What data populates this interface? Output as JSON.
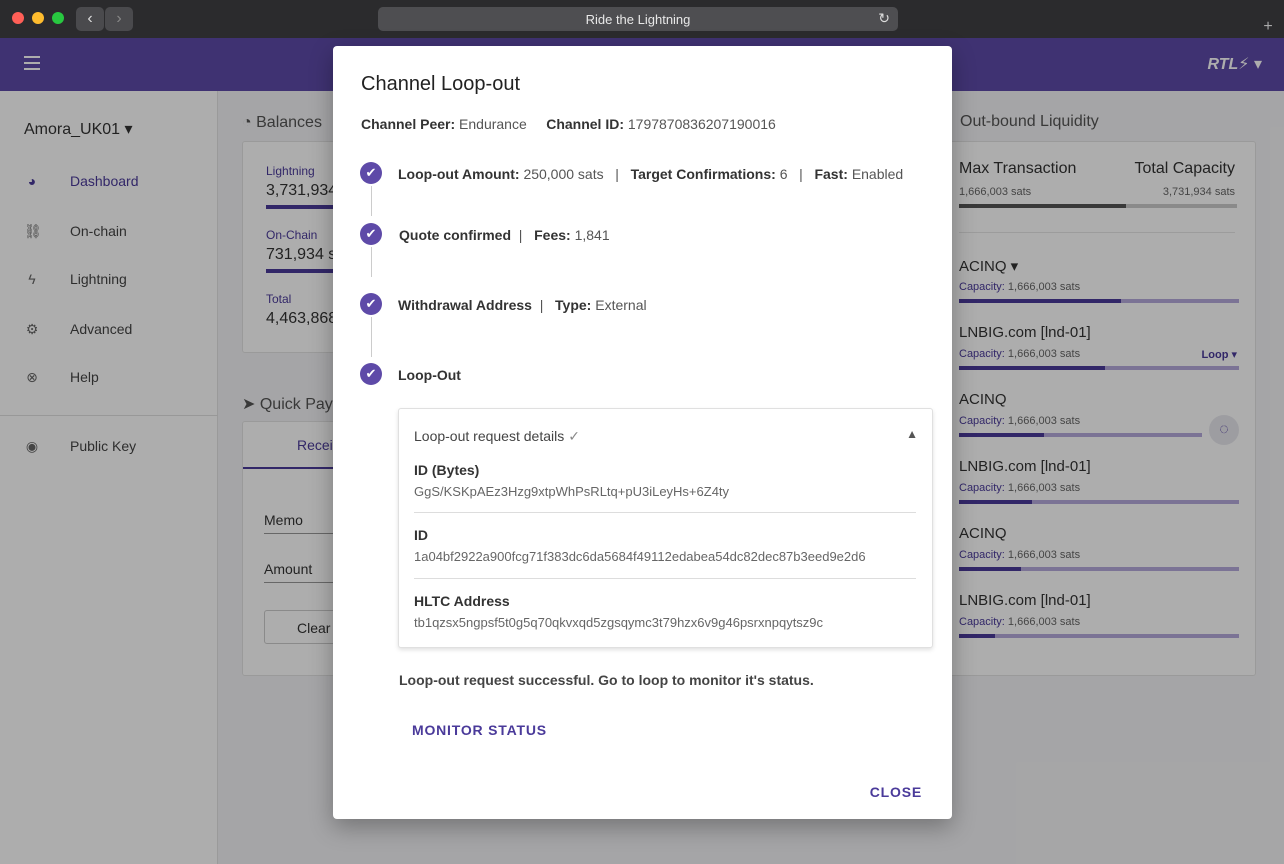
{
  "browser": {
    "url_title": "Ride the Lightning",
    "back_icon": "‹",
    "fwd_icon": "›",
    "new_tab": "+"
  },
  "header": {
    "logo": "RTL⚡ ▾"
  },
  "sidebar": {
    "node_name": "Amora_UK01 ▾",
    "items": [
      {
        "label": "Dashboard",
        "icon": "gauge-icon"
      },
      {
        "label": "On-chain",
        "icon": "link-icon"
      },
      {
        "label": "Lightning",
        "icon": "bolt-icon"
      },
      {
        "label": "Advanced",
        "icon": "gear-icon"
      },
      {
        "label": "Help",
        "icon": "help-icon"
      },
      {
        "label": "Public Key",
        "icon": "eye-icon"
      }
    ]
  },
  "balances": {
    "title": "Balances",
    "lightning_label": "Lightning",
    "lightning_value": "3,731,934",
    "onchain_label": "On-Chain",
    "onchain_value": "731,934 s",
    "total_label": "Total",
    "total_value": "4,463,868"
  },
  "quick_pay": {
    "title": "Quick Pay",
    "tab": "Receiv",
    "memo": "Memo",
    "amount": "Amount",
    "clear": "Clear"
  },
  "liquidity": {
    "title": "Out-bound Liquidity",
    "max_tx_label": "Max Transaction",
    "max_tx_value": "1,666,003 sats",
    "total_cap_label": "Total Capacity",
    "total_cap_value": "3,731,934 sats",
    "channels": [
      {
        "name": "ACINQ ▾",
        "capacity_label": "Capacity:",
        "capacity": "1,666,003 sats",
        "fill": 0.58
      },
      {
        "name": "LNBIG.com [lnd-01]",
        "capacity_label": "Capacity:",
        "capacity": "1,666,003 sats",
        "fill": 0.52,
        "action": "Loop ▾"
      },
      {
        "name": "ACINQ",
        "capacity_label": "Capacity:",
        "capacity": "1,666,003 sats",
        "fill": 0.35
      },
      {
        "name": "LNBIG.com [lnd-01]",
        "capacity_label": "Capacity:",
        "capacity": "1,666,003 sats",
        "fill": 0.26
      },
      {
        "name": "ACINQ",
        "capacity_label": "Capacity:",
        "capacity": "1,666,003 sats",
        "fill": 0.22
      },
      {
        "name": "LNBIG.com [lnd-01]",
        "capacity_label": "Capacity:",
        "capacity": "1,666,003 sats",
        "fill": 0.13
      }
    ]
  },
  "modal": {
    "title": "Channel Loop-out",
    "peer_label": "Channel Peer:",
    "peer_value": "Endurance",
    "channel_id_label": "Channel ID:",
    "channel_id_value": "1797870836207190016",
    "steps": [
      {
        "b1": "Loop-out Amount:",
        "v1": "250,000 sats",
        "b2": "Target Confirmations:",
        "v2": "6",
        "b3": "Fast:",
        "v3": "Enabled"
      },
      {
        "b1": "Quote confirmed",
        "b2": "Fees:",
        "v2": "1,841"
      },
      {
        "b1": "Withdrawal Address",
        "b2": "Type:",
        "v2": "External"
      },
      {
        "b1": "Loop-Out"
      }
    ],
    "panel_title": "Loop-out request details",
    "panel_check": "✓",
    "id_bytes_label": "ID (Bytes)",
    "id_bytes_value": "GgS/KSKpAEz3Hzg9xtpWhPsRLtq+pU3iLeyHs+6Z4ty",
    "id_label": "ID",
    "id_value": "1a04bf2922a900fcg71f383dc6da5684f49112edabea54dc82dec87b3eed9e2d6",
    "hltc_label": "HLTC Address",
    "hltc_value": "tb1qzsx5ngpsf5t0g5q70qkvxqd5zgsqymc3t79hzx6v9g46psrxnpqytsz9c",
    "success": "Loop-out request successful. Go to loop to monitor it's status.",
    "monitor_btn": "MONITOR STATUS",
    "close_btn": "CLOSE"
  }
}
